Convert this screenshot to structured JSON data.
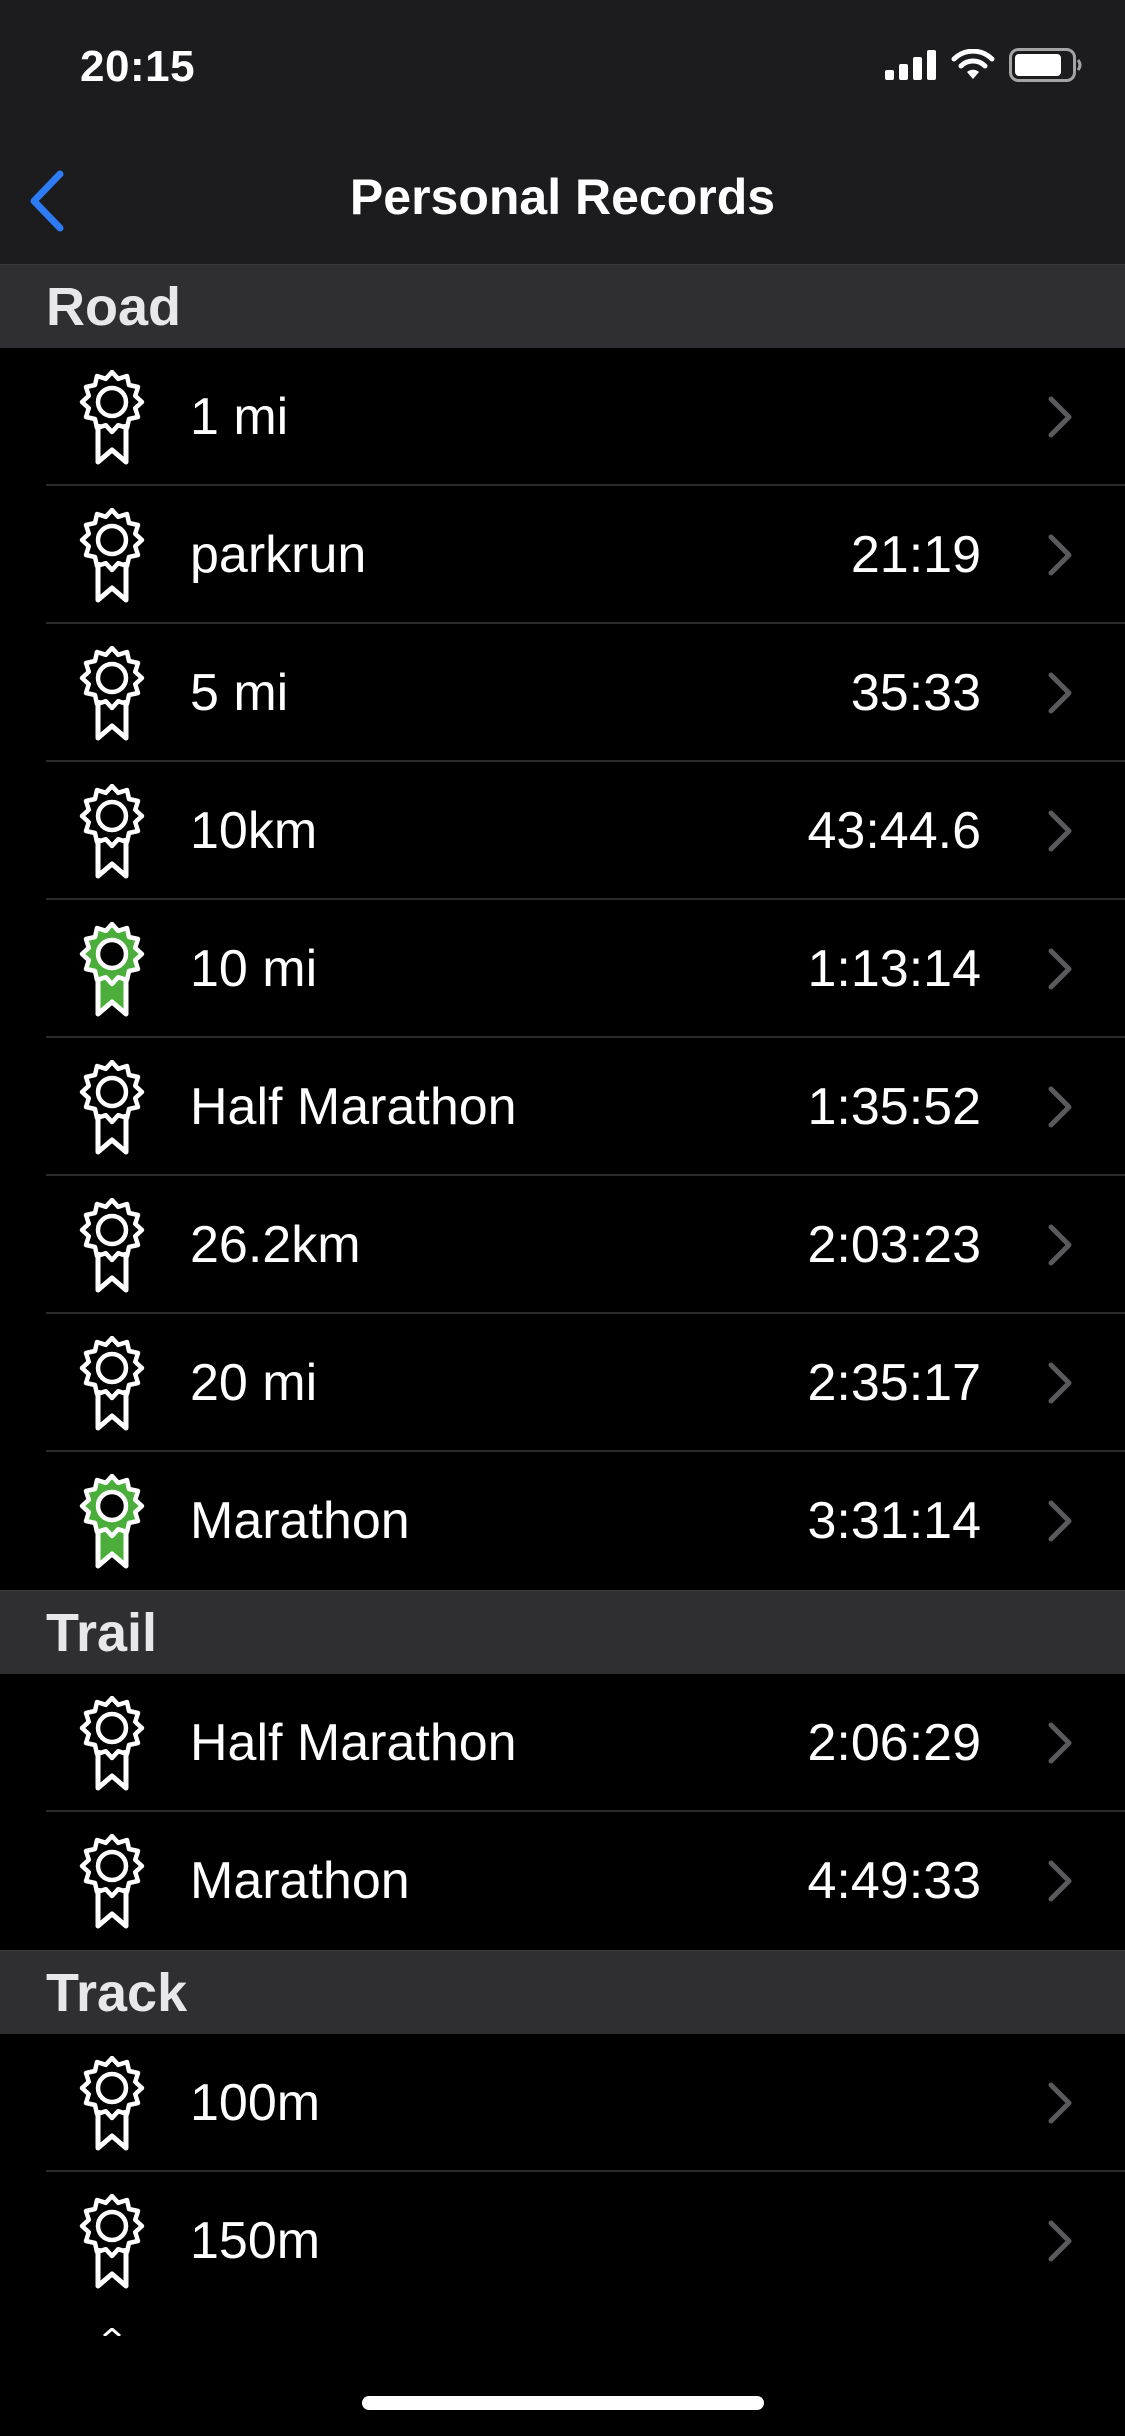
{
  "status_bar": {
    "time": "20:15",
    "icons": [
      "cellular-signal-icon",
      "wifi-icon",
      "battery-icon"
    ]
  },
  "nav": {
    "back_icon": "chevron-left-icon",
    "title": "Personal Records"
  },
  "colors": {
    "accent_blue": "#2d7cf6",
    "medal_green": "#4cae3a",
    "medal_white": "#ffffff",
    "header_bg": "#1c1c1e",
    "section_bg": "#2f2f31"
  },
  "sections": [
    {
      "title": "Road",
      "rows": [
        {
          "label": "1 mi",
          "value": "",
          "medal": "white"
        },
        {
          "label": "parkrun",
          "value": "21:19",
          "medal": "white"
        },
        {
          "label": "5 mi",
          "value": "35:33",
          "medal": "white"
        },
        {
          "label": "10km",
          "value": "43:44.6",
          "medal": "white"
        },
        {
          "label": "10 mi",
          "value": "1:13:14",
          "medal": "green"
        },
        {
          "label": "Half Marathon",
          "value": "1:35:52",
          "medal": "white"
        },
        {
          "label": "26.2km",
          "value": "2:03:23",
          "medal": "white"
        },
        {
          "label": "20 mi",
          "value": "2:35:17",
          "medal": "white"
        },
        {
          "label": "Marathon",
          "value": "3:31:14",
          "medal": "green"
        }
      ]
    },
    {
      "title": "Trail",
      "rows": [
        {
          "label": "Half Marathon",
          "value": "2:06:29",
          "medal": "white"
        },
        {
          "label": "Marathon",
          "value": "4:49:33",
          "medal": "white"
        }
      ]
    },
    {
      "title": "Track",
      "rows": [
        {
          "label": "100m",
          "value": "",
          "medal": "white"
        },
        {
          "label": "150m",
          "value": "",
          "medal": "white"
        }
      ]
    }
  ]
}
